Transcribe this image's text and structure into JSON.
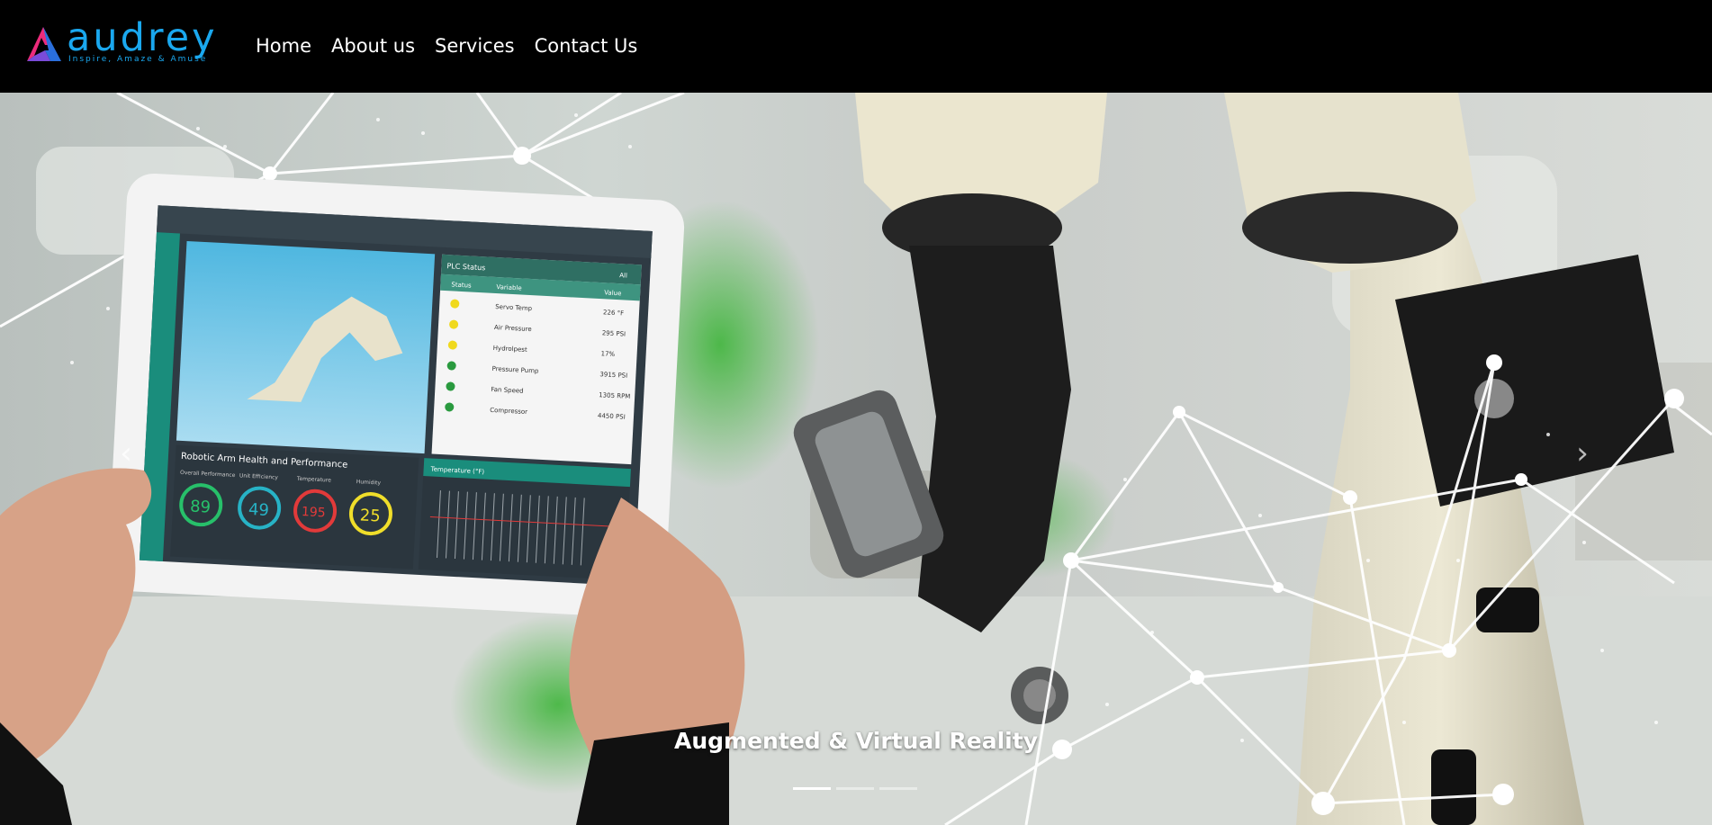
{
  "brand": {
    "name": "audrey",
    "tagline": "Inspire, Amaze & Amuse",
    "colors": {
      "accent": "#1aa8ef",
      "mark_pink": "#ec2b7b",
      "mark_blue": "#2a6fdc",
      "nav_bg": "#000000"
    }
  },
  "nav": {
    "items": [
      {
        "label": "Home"
      },
      {
        "label": "About us"
      },
      {
        "label": "Services"
      },
      {
        "label": "Contact Us"
      }
    ]
  },
  "carousel": {
    "caption": "Augmented & Virtual Reality",
    "slide_count": 3,
    "active_index": 0,
    "prev_icon": "chevron-left-icon",
    "next_icon": "chevron-right-icon",
    "tablet": {
      "panel_title": "PLC Status",
      "panel_filter": "All",
      "columns": [
        "Status",
        "Variable",
        "Value"
      ],
      "rows": [
        {
          "status": "yellow",
          "name": "Servo Temp",
          "value": "226 °F"
        },
        {
          "status": "yellow",
          "name": "Air Pressure",
          "value": "295 PSI"
        },
        {
          "status": "yellow",
          "name": "Hydrolpest",
          "value": "17%"
        },
        {
          "status": "green",
          "name": "Pressure Pump",
          "value": "3915 PSI"
        },
        {
          "status": "green",
          "name": "Fan Speed",
          "value": "1305 RPM"
        },
        {
          "status": "green",
          "name": "Compressor",
          "value": "4450 PSI"
        }
      ],
      "health_title": "Robotic Arm Health and Performance",
      "gauges": [
        {
          "label": "Overall Performance",
          "value": "89",
          "color": "#27c06a"
        },
        {
          "label": "Unit Efficiency",
          "value": "49",
          "color": "#27b3c6"
        },
        {
          "label": "Temperature",
          "value": "195",
          "color": "#e23a3a"
        },
        {
          "label": "Humidity",
          "value": "25",
          "color": "#f0de2a"
        }
      ],
      "temp_title": "Temperature (°F)"
    }
  }
}
